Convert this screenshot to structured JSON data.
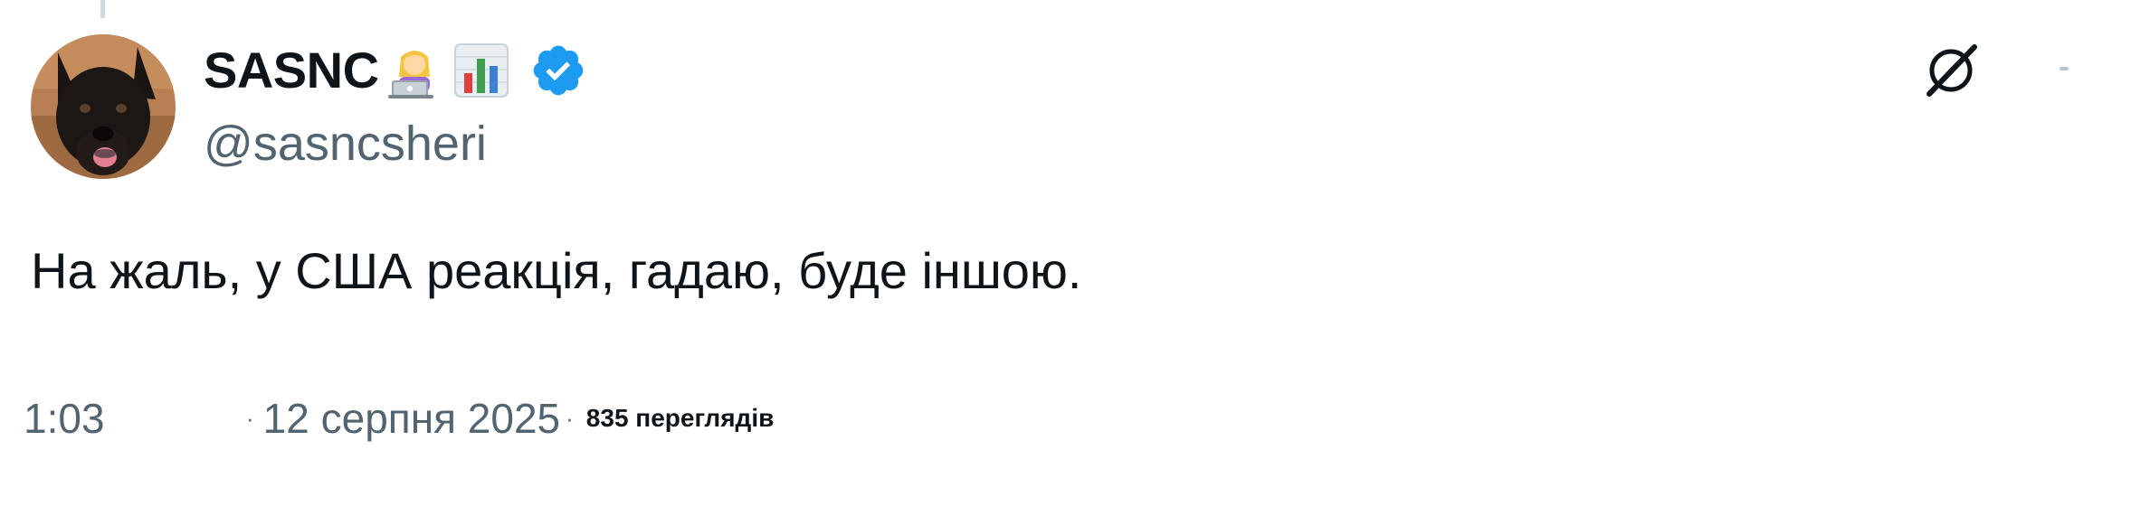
{
  "author": {
    "display_name": "SASNC",
    "name_emojis": [
      "woman-technologist-emoji",
      "bar-chart-emoji"
    ],
    "handle": "@sasncsheri",
    "verified": true,
    "verified_color": "#1d9bf0"
  },
  "tweet": {
    "text": "На жаль, у США реакція, гадаю, буде іншою."
  },
  "meta": {
    "time": "1:03",
    "separator": "·",
    "date": "12 серпня 2025",
    "views": "835 переглядів"
  },
  "colors": {
    "text_primary": "#0f1419",
    "text_secondary": "#536471"
  }
}
